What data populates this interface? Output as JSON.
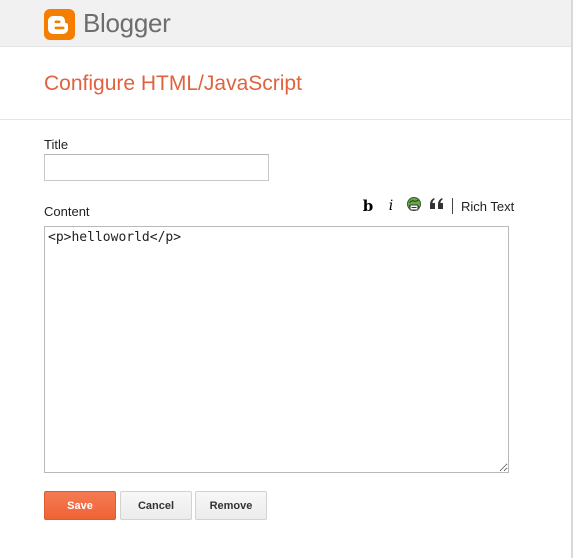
{
  "header": {
    "brand": "Blogger"
  },
  "page": {
    "title": "Configure HTML/JavaScript"
  },
  "form": {
    "title_label": "Title",
    "title_value": "",
    "content_label": "Content",
    "content_value": "<p>helloworld</p>"
  },
  "toolbar": {
    "bold_label": "b",
    "italic_label": "i",
    "link_icon": "link-icon",
    "quote_label": "“",
    "rich_text_label": "Rich Text"
  },
  "buttons": {
    "save": "Save",
    "cancel": "Cancel",
    "remove": "Remove"
  },
  "colors": {
    "accent": "#e0623e",
    "save_button": "#f36a45",
    "logo": "#f57d00"
  }
}
